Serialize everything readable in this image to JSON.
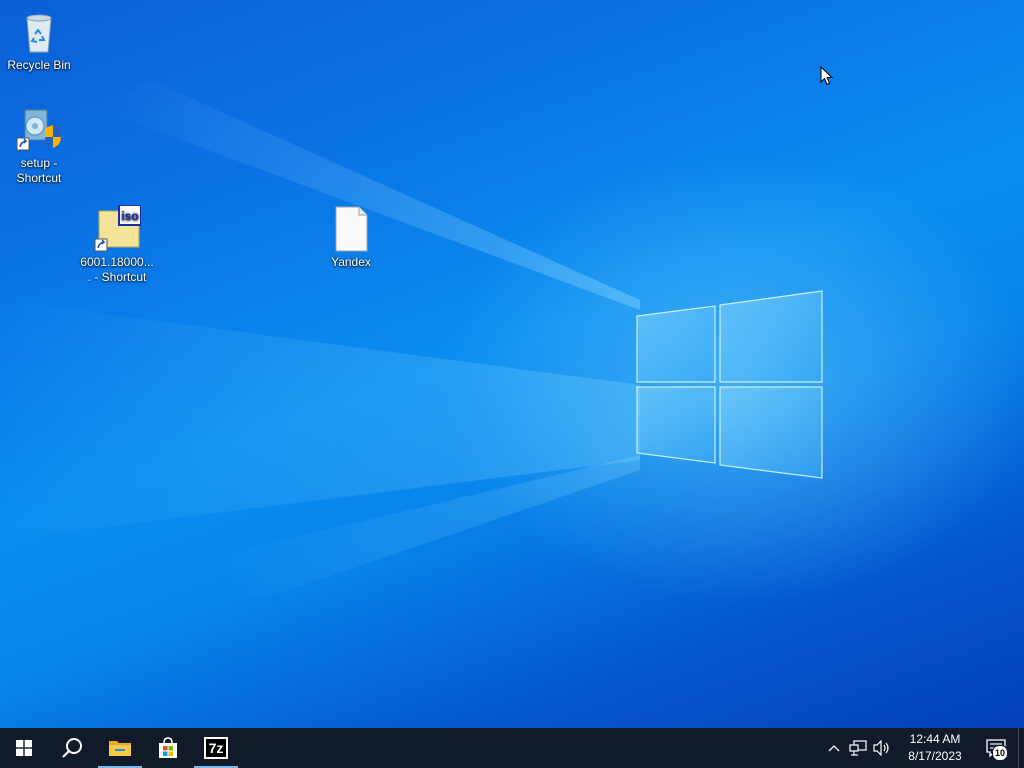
{
  "desktop": {
    "icons": [
      {
        "label": "Recycle Bin",
        "icon": "recycle-bin-icon"
      },
      {
        "label": "setup - Shortcut",
        "icon": "setup-shortcut-icon"
      },
      {
        "label": "6001.18000.... - Shortcut",
        "icon": "iso-shortcut-icon"
      },
      {
        "label": "Yandex",
        "icon": "blank-file-icon"
      }
    ]
  },
  "taskbar": {
    "start": {
      "icon": "windows-logo-icon"
    },
    "search": {
      "icon": "search-icon"
    },
    "pinned": [
      {
        "name": "File Explorer",
        "icon": "folder-icon",
        "active": true
      },
      {
        "name": "Microsoft Store",
        "icon": "store-bag-icon",
        "active": false
      },
      {
        "name": "7-Zip",
        "icon": "7zip-icon",
        "icon_text": "7z",
        "active": true
      }
    ],
    "tray": {
      "chevron_icon": "chevron-up-icon",
      "network_icon": "network-icon",
      "volume_icon": "volume-icon",
      "time": "12:44 AM",
      "date": "8/17/2023",
      "notifications_count": "10"
    }
  },
  "colors": {
    "taskbar": "#101a28",
    "accent": "#76b9ed",
    "desktop_blue": "#0a8ef0"
  }
}
